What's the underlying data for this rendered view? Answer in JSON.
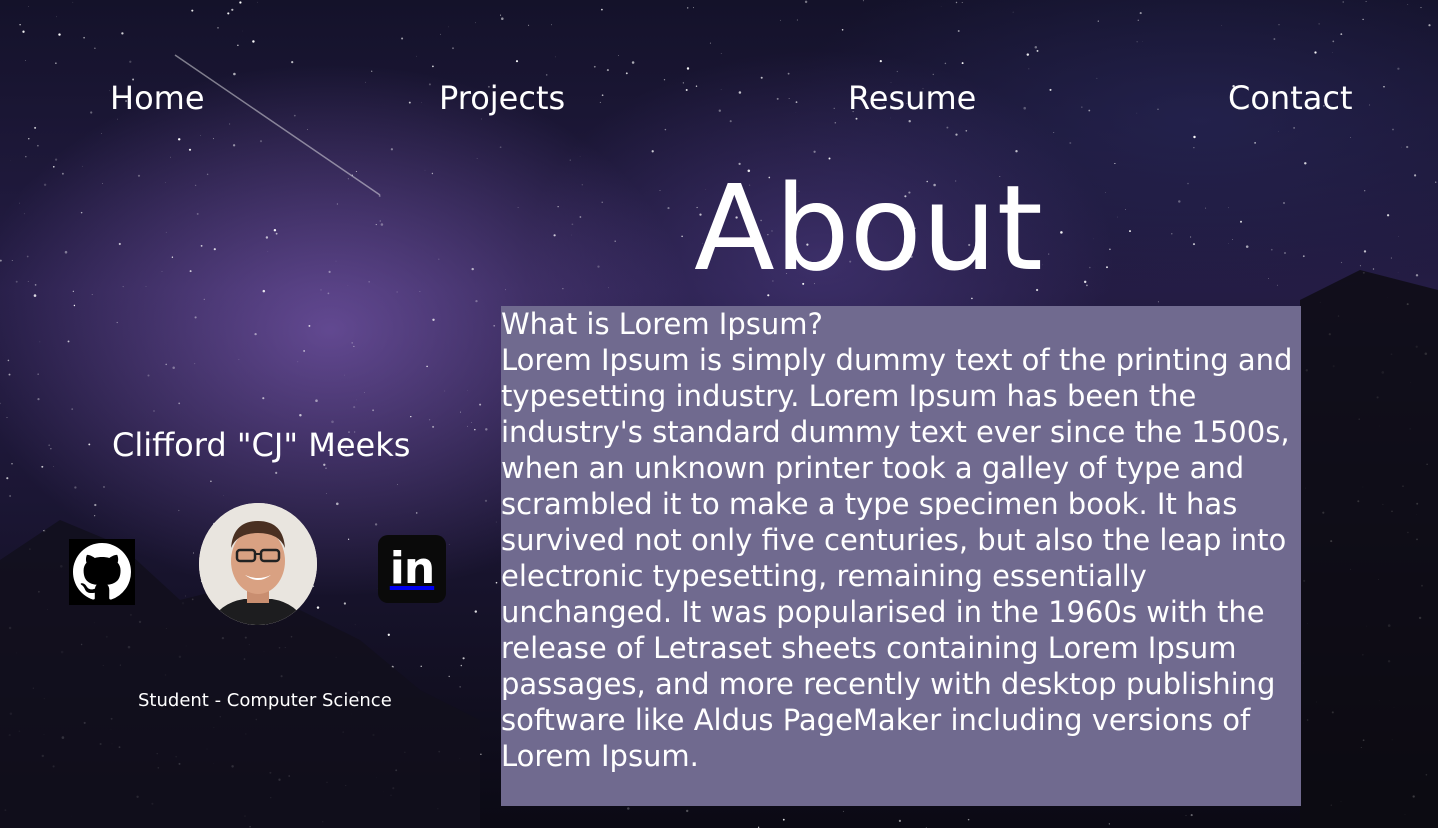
{
  "nav": {
    "items": [
      {
        "label": "Home"
      },
      {
        "label": "Projects"
      },
      {
        "label": "Resume"
      },
      {
        "label": "Contact"
      }
    ]
  },
  "page": {
    "title": "About"
  },
  "profile": {
    "name": "Clifford \"CJ\" Meeks",
    "subtitle": "Student - Computer Science",
    "social": [
      {
        "icon": "github-icon"
      },
      {
        "icon": "linkedin-icon",
        "glyph": "in"
      }
    ]
  },
  "about": {
    "heading": "What is Lorem Ipsum?",
    "body": "Lorem Ipsum is simply dummy text of the printing and typesetting industry. Lorem Ipsum has been the industry's standard dummy text ever since the 1500s, when an unknown printer took a galley of type and scrambled it to make a type specimen book. It has survived not only five centuries, but also the leap into electronic typesetting, remaining essentially unchanged. It was popularised in the 1960s with the release of Letraset sheets containing Lorem Ipsum passages, and more recently with desktop publishing software like Aldus PageMaker including versions of Lorem Ipsum."
  },
  "colors": {
    "about_box": "#706a8f",
    "text": "#ffffff"
  }
}
